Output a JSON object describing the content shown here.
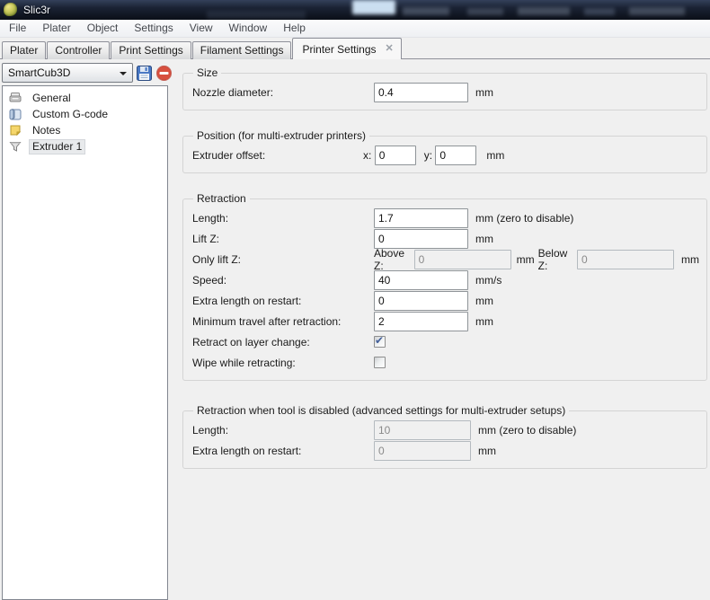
{
  "window": {
    "title": "Slic3r"
  },
  "menubar": {
    "items": [
      "File",
      "Plater",
      "Object",
      "Settings",
      "View",
      "Window",
      "Help"
    ]
  },
  "tabs": {
    "items": [
      "Plater",
      "Controller",
      "Print Settings",
      "Filament Settings"
    ],
    "active": "Printer Settings",
    "close_glyph": "✕"
  },
  "sidebar": {
    "preset_select": {
      "value": "SmartCub3D"
    },
    "toolbar": {
      "save_icon": "floppy-disk",
      "delete_icon": "red-minus-circle"
    },
    "tree": [
      {
        "icon": "printer-icon",
        "label": "General",
        "selected": false
      },
      {
        "icon": "gcode-scroll-icon",
        "label": "Custom G-code",
        "selected": false
      },
      {
        "icon": "note-icon",
        "label": "Notes",
        "selected": false
      },
      {
        "icon": "funnel-icon",
        "label": "Extruder 1",
        "selected": true
      }
    ]
  },
  "sections": {
    "size": {
      "legend": "Size",
      "nozzle": {
        "label": "Nozzle diameter:",
        "value": "0.4",
        "unit": "mm"
      }
    },
    "position": {
      "legend": "Position (for multi-extruder printers)",
      "offset": {
        "label": "Extruder offset:",
        "x_label": "x:",
        "x_value": "0",
        "y_label": "y:",
        "y_value": "0",
        "unit": "mm"
      }
    },
    "retraction": {
      "legend": "Retraction",
      "length": {
        "label": "Length:",
        "value": "1.7",
        "unit": "mm (zero to disable)"
      },
      "lift_z": {
        "label": "Lift Z:",
        "value": "0",
        "unit": "mm"
      },
      "only_lift": {
        "label": "Only lift Z:",
        "above_label": "Above Z:",
        "above_value": "0",
        "mid_unit": "mm",
        "below_label": "Below Z:",
        "below_value": "0",
        "unit": "mm",
        "disabled": true
      },
      "speed": {
        "label": "Speed:",
        "value": "40",
        "unit": "mm/s"
      },
      "extra": {
        "label": "Extra length on restart:",
        "value": "0",
        "unit": "mm"
      },
      "min_travel": {
        "label": "Minimum travel after retraction:",
        "value": "2",
        "unit": "mm"
      },
      "layer_change": {
        "label": "Retract on layer change:",
        "checked": true
      },
      "wipe": {
        "label": "Wipe while retracting:",
        "checked": false
      }
    },
    "retraction_disabled": {
      "legend": "Retraction when tool is disabled (advanced settings for multi-extruder setups)",
      "length": {
        "label": "Length:",
        "value": "10",
        "unit": "mm (zero to disable)",
        "disabled": true
      },
      "extra": {
        "label": "Extra length on restart:",
        "value": "0",
        "unit": "mm",
        "disabled": true
      }
    }
  },
  "colors": {
    "titlebar_dark": "#141a27",
    "save_icon_blue": "#3b66ae",
    "delete_icon_red": "#cc3a2a",
    "check_blue": "#44609a",
    "selection_bg": "#e8eaec",
    "panel_bg": "#f0f0f0"
  }
}
